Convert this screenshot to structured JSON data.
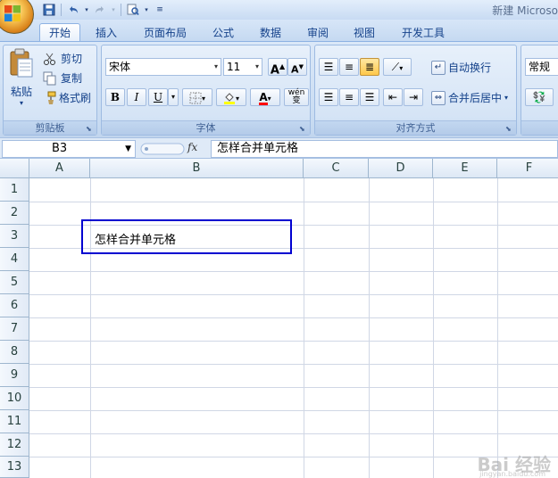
{
  "window": {
    "title": "新建 Microso"
  },
  "quick_access": [
    "save-icon",
    "undo-icon",
    "redo-icon",
    "print-preview-icon",
    "customize-icon"
  ],
  "tabs": [
    {
      "label": "开始",
      "active": true
    },
    {
      "label": "插入"
    },
    {
      "label": "页面布局"
    },
    {
      "label": "公式"
    },
    {
      "label": "数据"
    },
    {
      "label": "审阅"
    },
    {
      "label": "视图"
    },
    {
      "label": "开发工具"
    }
  ],
  "ribbon": {
    "clipboard": {
      "label": "剪贴板",
      "paste": "粘贴",
      "cut": "剪切",
      "copy": "复制",
      "format_painter": "格式刷"
    },
    "font": {
      "label": "字体",
      "font_name": "宋体",
      "font_size": "11",
      "bold": "B",
      "italic": "I",
      "underline": "U",
      "phonetic": "wén\n变"
    },
    "alignment": {
      "label": "对齐方式",
      "wrap_text": "自动换行",
      "merge_center": "合并后居中"
    },
    "number": {
      "format": "常规"
    }
  },
  "formula_bar": {
    "name_box": "B3",
    "fx": "fx",
    "content": "怎样合并单元格"
  },
  "grid": {
    "columns": [
      "A",
      "B",
      "C",
      "D",
      "E",
      "F"
    ],
    "rows": [
      "1",
      "2",
      "3",
      "4",
      "5",
      "6",
      "7",
      "8",
      "9",
      "10",
      "11",
      "12",
      "13"
    ],
    "cells": {
      "B3": "怎样合并单元格"
    }
  },
  "watermark": {
    "main": "Bai 经验",
    "sub": "jingyan.baidu.com"
  },
  "colors": {
    "accent": "#0000d0",
    "ribbon": "#c9dcf2",
    "header": "#dde8f5"
  }
}
